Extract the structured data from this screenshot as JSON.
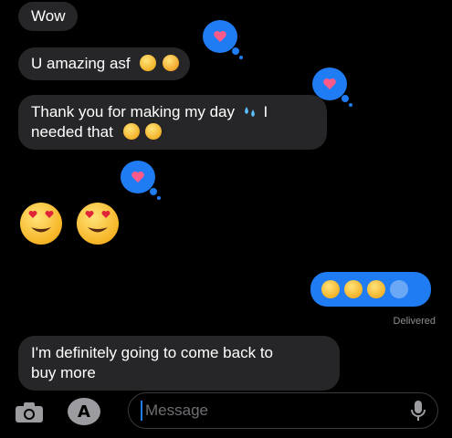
{
  "messages": {
    "wow": "Wow",
    "amazing": "U amazing asf",
    "thank_you_line1": "Thank you for making my day",
    "thank_you_line1_tail": "I",
    "thank_you_line2": "needed that",
    "definitely_line1": "I'm definitely going to come back to",
    "definitely_line2": "buy more"
  },
  "status": {
    "delivered": "Delivered"
  },
  "input": {
    "placeholder": "Message"
  },
  "colors": {
    "background": "#000000",
    "incoming_bubble": "#262628",
    "outgoing_bubble": "#1f7cf2",
    "tapback_heart": "#ff5a8a"
  },
  "icons": {
    "camera": "camera-icon",
    "apps": "app-store-icon",
    "mic": "microphone-icon",
    "heart": "heart-icon"
  }
}
